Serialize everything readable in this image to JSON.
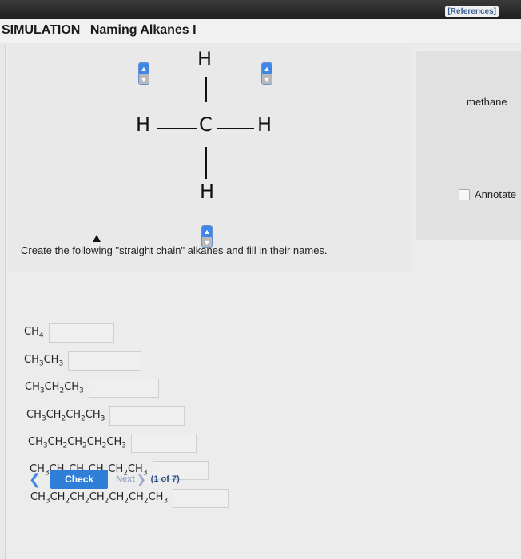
{
  "header": {
    "references": "[References]",
    "simulation_label": "SIMULATION",
    "title": "Naming Alkanes I"
  },
  "molecule": {
    "top_atom": "H",
    "left_atom": "H",
    "center_atom": "C",
    "right_atom": "H",
    "bottom_atom": "H",
    "spinner_up_icon": "arrow-up-icon",
    "spinner_down_icon": "arrow-down-icon"
  },
  "side": {
    "name": "methane",
    "annotate_label": "Annotate"
  },
  "instructions": "Create the following \"straight chain\" alkanes and fill in their names.",
  "rows": [
    {
      "formula": [
        "CH",
        "4",
        ""
      ],
      "value": "",
      "placeholder": ""
    },
    {
      "formula": [
        "CH",
        "3",
        "CH",
        "3"
      ],
      "value": "",
      "placeholder": ""
    },
    {
      "formula": [
        "CH",
        "3",
        "CH",
        "2",
        "CH",
        "3"
      ],
      "value": "",
      "placeholder": ""
    },
    {
      "formula": [
        "CH",
        "3",
        "CH",
        "2",
        "CH",
        "2",
        "CH",
        "3"
      ],
      "value": "",
      "placeholder": ""
    },
    {
      "formula": [
        "CH",
        "3",
        "CH",
        "2",
        "CH",
        "2",
        "CH",
        "2",
        "CH",
        "3"
      ],
      "value": "",
      "placeholder": ""
    },
    {
      "formula": [
        "CH",
        "3",
        "CH",
        "2",
        "CH",
        "2",
        "CH",
        "2",
        "CH",
        "2",
        "CH",
        "3"
      ],
      "value": "",
      "placeholder": ""
    },
    {
      "formula": [
        "CH",
        "3",
        "CH",
        "2",
        "CH",
        "2",
        "CH",
        "2",
        "CH",
        "2",
        "CH",
        "2",
        "CH",
        "3"
      ],
      "value": "",
      "placeholder": ""
    }
  ],
  "footer": {
    "back_icon": "chevron-left-icon",
    "check_label": "Check",
    "next_label": "Next",
    "next_icon": "chevron-right-icon",
    "page_count": "(1 of 7)"
  }
}
